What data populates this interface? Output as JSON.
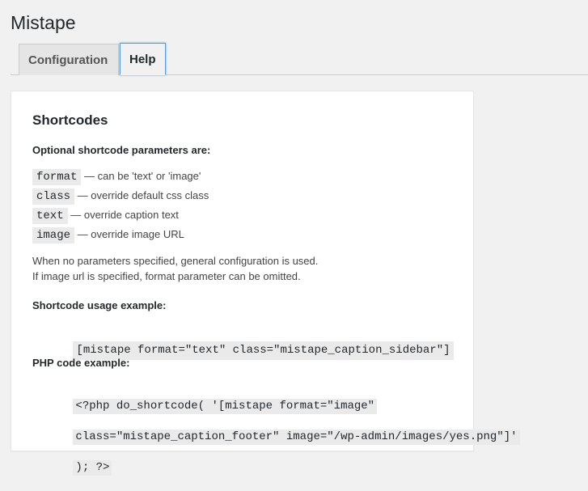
{
  "page": {
    "title": "Mistape"
  },
  "tabs": [
    {
      "label": "Configuration",
      "active": false
    },
    {
      "label": "Help",
      "active": true
    }
  ],
  "help": {
    "heading": "Shortcodes",
    "params_intro": "Optional shortcode parameters are:",
    "params": [
      {
        "name": "format",
        "desc": "— can be 'text' or 'image'"
      },
      {
        "name": "class",
        "desc": "— override default css class"
      },
      {
        "name": "text",
        "desc": "— override caption text"
      },
      {
        "name": "image",
        "desc": "— override image URL"
      }
    ],
    "note_line1": "When no parameters specified, general configuration is used.",
    "note_line2": "If image url is specified, format parameter can be omitted.",
    "usage_heading": "Shortcode usage example:",
    "usage_code": "[mistape format=\"text\" class=\"mistape_caption_sidebar\"]",
    "php_heading": "PHP code example:",
    "php_code_line1": "<?php do_shortcode( '[mistape format=\"image\"",
    "php_code_line2": "class=\"mistape_caption_footer\" image=\"/wp-admin/images/yes.png\"]'",
    "php_code_line3": "); ?>"
  },
  "colors": {
    "background": "#f1f1f1",
    "panel": "#ffffff",
    "code_bg": "#eaeaea",
    "active_tab_border": "#5b9dd9"
  }
}
